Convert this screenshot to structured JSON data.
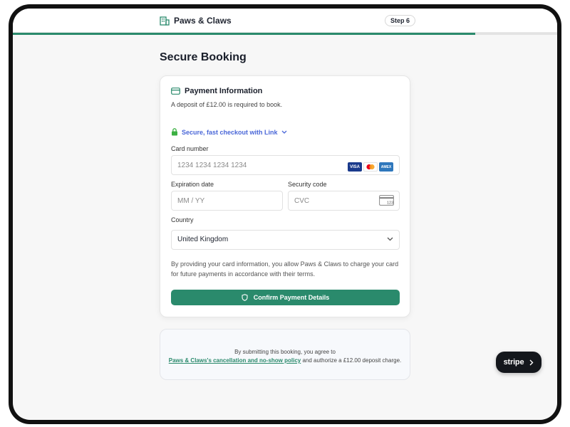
{
  "header": {
    "brand_name": "Paws & Claws",
    "step_label": "Step 6",
    "progress_fraction": 0.85
  },
  "page": {
    "title": "Secure Booking"
  },
  "payment": {
    "heading": "Payment Information",
    "deposit_text": "A deposit of £12.00 is required to book.",
    "link_text": "Secure, fast checkout with Link",
    "card_number_label": "Card number",
    "card_number_placeholder": "1234 1234 1234 1234",
    "card_brands": [
      "VISA",
      "Mastercard",
      "AMEX"
    ],
    "expiry_label": "Expiration date",
    "expiry_placeholder": "MM / YY",
    "cvc_label": "Security code",
    "cvc_placeholder": "CVC",
    "cvc_icon_number": "123",
    "country_label": "Country",
    "country_value": "United Kingdom",
    "terms_text": "By providing your card information, you allow Paws & Claws to charge your card for future payments in accordance with their terms.",
    "confirm_label": "Confirm Payment Details"
  },
  "agreement": {
    "line1": "By submitting this booking, you agree to",
    "policy_link": "Paws & Claws's cancellation and no-show policy",
    "line2_suffix": " and authorize a £12.00 deposit charge."
  },
  "stripe_badge": {
    "label": "stripe"
  },
  "colors": {
    "accent": "#2a8a6c",
    "link": "#4a67d8",
    "lock": "#3cb043"
  }
}
